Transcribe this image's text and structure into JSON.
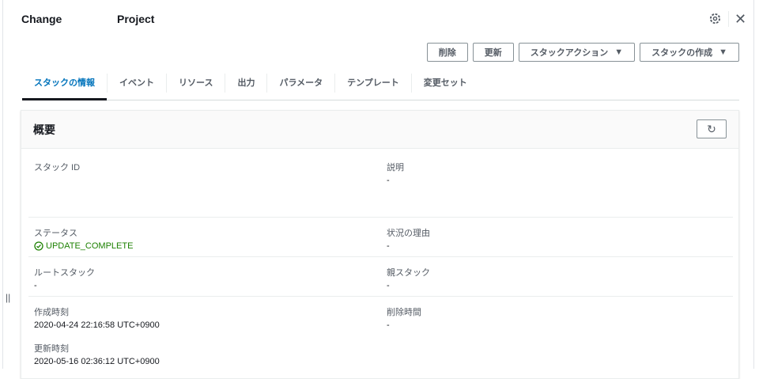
{
  "header": {
    "title_left": "Change",
    "title_right": "Project"
  },
  "toolbar": {
    "delete": "削除",
    "update": "更新",
    "stack_actions": "スタックアクション",
    "create_stack": "スタックの作成",
    "caret": "▼"
  },
  "tabs": [
    "スタックの情報",
    "イベント",
    "リソース",
    "出力",
    "パラメータ",
    "テンプレート",
    "変更セット"
  ],
  "overview": {
    "title": "概要",
    "fields": {
      "stack_id": {
        "label": "スタック ID",
        "value": ""
      },
      "description": {
        "label": "説明",
        "value": "-"
      },
      "status": {
        "label": "ステータス",
        "value": "UPDATE_COMPLETE"
      },
      "status_reason": {
        "label": "状況の理由",
        "value": "-"
      },
      "root_stack": {
        "label": "ルートスタック",
        "value": "-"
      },
      "parent_stack": {
        "label": "親スタック",
        "value": "-"
      },
      "created": {
        "label": "作成時刻",
        "value": "2020-04-24 22:16:58 UTC+0900"
      },
      "deleted": {
        "label": "削除時間",
        "value": "-"
      },
      "updated": {
        "label": "更新時刻",
        "value": "2020-05-16 02:36:12 UTC+0900"
      }
    }
  },
  "colors": {
    "accent": "#0073bb",
    "success": "#1d8102"
  }
}
